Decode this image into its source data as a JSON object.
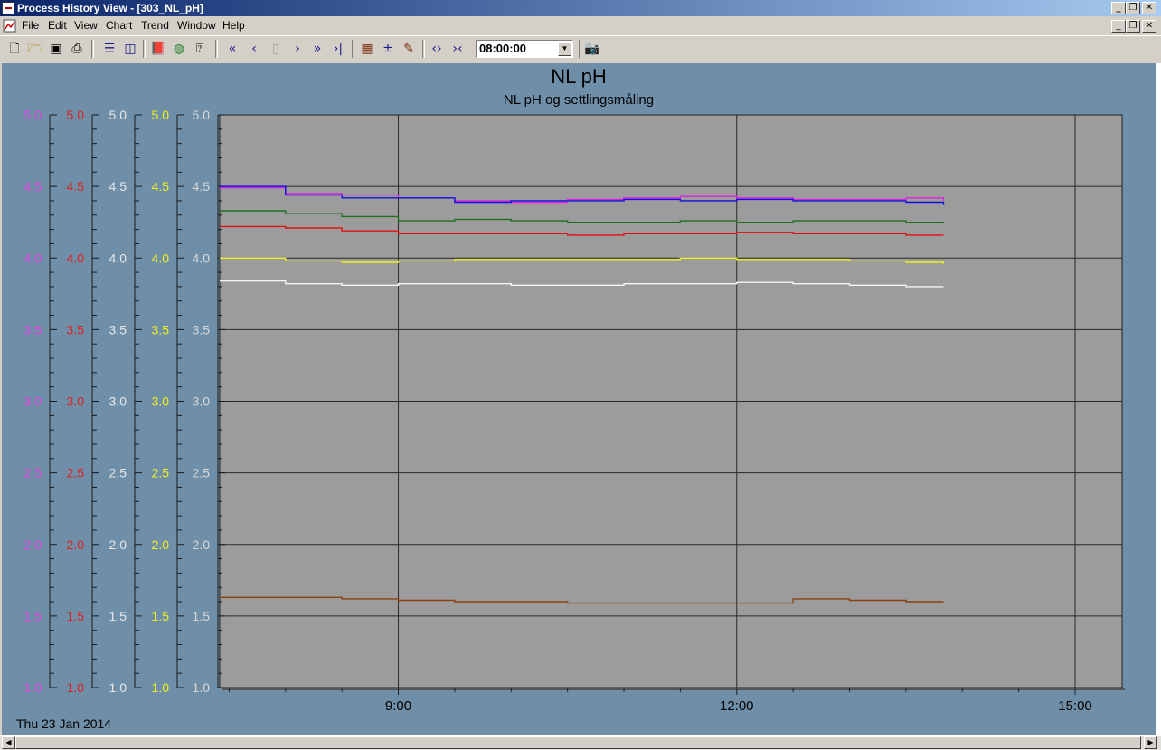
{
  "window": {
    "title": "Process History View - [303_NL_pH]"
  },
  "menu": [
    "File",
    "Edit",
    "View",
    "Chart",
    "Trend",
    "Window",
    "Help"
  ],
  "toolbar": {
    "time_value": "08:00:00"
  },
  "chart_data": {
    "type": "line",
    "title": "NL pH",
    "subtitle": "NL pH og settlingsmåling",
    "date_label": "Thu 23 Jan 2014",
    "x_ticks": [
      "9:00",
      "12:00",
      "15:00"
    ],
    "xlim": [
      "07:25",
      "15:25"
    ],
    "ylim": [
      1.0,
      5.0
    ],
    "y_ticks": [
      "1.0",
      "1.5",
      "2.0",
      "2.5",
      "3.0",
      "3.5",
      "4.0",
      "4.5",
      "5.0"
    ],
    "axes": [
      {
        "color": "#e040e0",
        "ylim": [
          1.0,
          5.0
        ]
      },
      {
        "color": "#e02020",
        "ylim": [
          1.0,
          5.0
        ]
      },
      {
        "color": "#e8e8e8",
        "ylim": [
          1.0,
          5.0
        ]
      },
      {
        "color": "#f0f020",
        "ylim": [
          1.0,
          5.0
        ]
      },
      {
        "color": "#d8d8d8",
        "ylim": [
          1.0,
          5.0
        ]
      }
    ],
    "x": [
      "07:25",
      "08:00",
      "08:30",
      "09:00",
      "09:30",
      "10:00",
      "10:30",
      "11:00",
      "11:30",
      "12:00",
      "12:30",
      "13:00",
      "13:30",
      "13:50"
    ],
    "series": [
      {
        "color": "#e020e0",
        "values": [
          4.49,
          4.45,
          4.44,
          4.42,
          4.4,
          4.39,
          4.41,
          4.42,
          4.43,
          4.42,
          4.41,
          4.41,
          4.42,
          4.4
        ]
      },
      {
        "color": "#1010e0",
        "values": [
          4.5,
          4.44,
          4.42,
          4.42,
          4.39,
          4.4,
          4.4,
          4.41,
          4.4,
          4.41,
          4.4,
          4.4,
          4.39,
          4.37
        ]
      },
      {
        "color": "#207020",
        "values": [
          4.33,
          4.31,
          4.29,
          4.26,
          4.27,
          4.26,
          4.25,
          4.25,
          4.26,
          4.25,
          4.26,
          4.26,
          4.25,
          4.24
        ]
      },
      {
        "color": "#e01010",
        "values": [
          4.22,
          4.21,
          4.19,
          4.17,
          4.17,
          4.17,
          4.16,
          4.17,
          4.17,
          4.18,
          4.17,
          4.17,
          4.16,
          4.16
        ]
      },
      {
        "color": "#f0f020",
        "values": [
          4.0,
          3.98,
          3.97,
          3.98,
          3.99,
          3.99,
          3.99,
          3.99,
          4.0,
          3.99,
          3.99,
          3.98,
          3.97,
          3.96
        ]
      },
      {
        "color": "#f4f4f4",
        "values": [
          3.84,
          3.82,
          3.81,
          3.82,
          3.82,
          3.81,
          3.81,
          3.82,
          3.82,
          3.83,
          3.82,
          3.81,
          3.8,
          3.8
        ]
      },
      {
        "color": "#8a4010",
        "values": [
          1.63,
          1.63,
          1.62,
          1.61,
          1.6,
          1.6,
          1.59,
          1.59,
          1.59,
          1.59,
          1.62,
          1.61,
          1.6,
          1.6
        ]
      }
    ],
    "grid": true
  }
}
